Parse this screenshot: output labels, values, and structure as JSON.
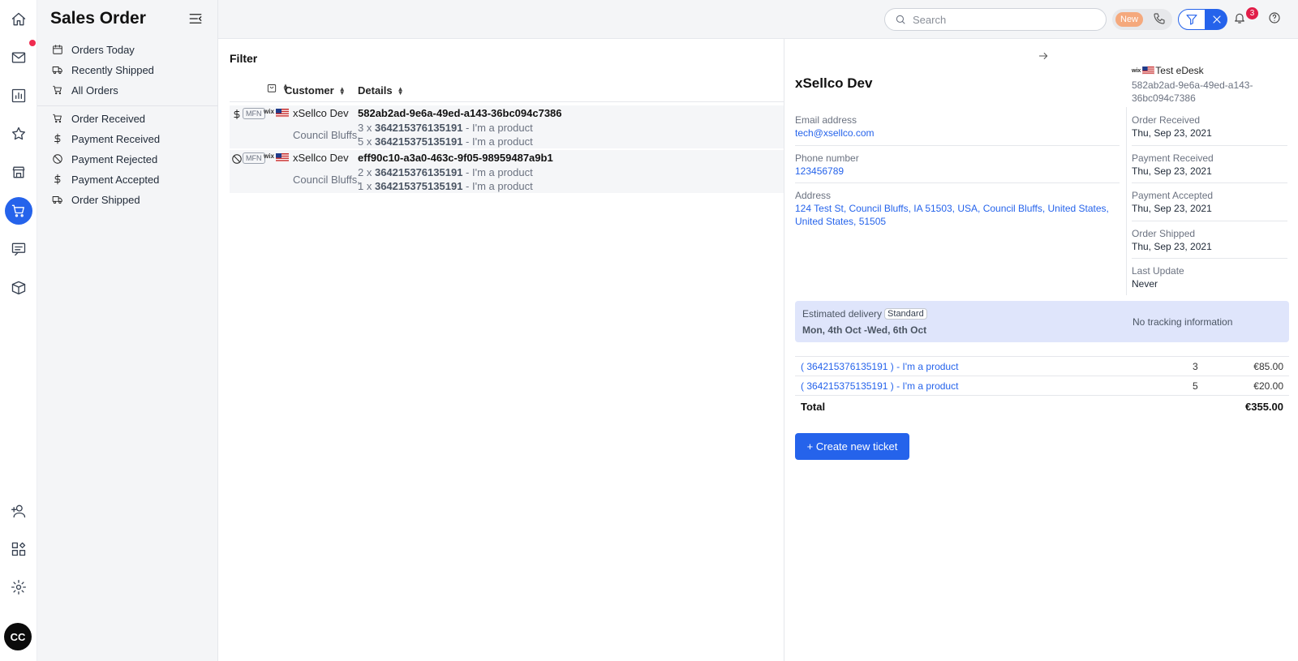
{
  "sidebar": {
    "title": "Sales Order",
    "items": [
      {
        "label": "Orders Today",
        "icon": "calendar-icon"
      },
      {
        "label": "Recently Shipped",
        "icon": "truck-icon"
      },
      {
        "label": "All Orders",
        "icon": "cart-icon"
      },
      {
        "label": "Order Received",
        "icon": "cart-icon"
      },
      {
        "label": "Payment Received",
        "icon": "dollar-icon"
      },
      {
        "label": "Payment Rejected",
        "icon": "ban-icon"
      },
      {
        "label": "Payment Accepted",
        "icon": "dollar-icon"
      },
      {
        "label": "Order Shipped",
        "icon": "truck-icon"
      }
    ]
  },
  "topbar": {
    "search_placeholder": "Search",
    "new_badge": "New",
    "notification_count": "3"
  },
  "list": {
    "filter_title": "Filter",
    "columns": {
      "customer": "Customer",
      "details": "Details"
    },
    "rows": [
      {
        "status_icon": "dollar-icon",
        "channel": "MFN",
        "marketplace": "wix",
        "customer": "xSellco Dev",
        "city": "Council Bluffs,",
        "order_id": "582ab2ad-9e6a-49ed-a143-36bc094c7386",
        "lines": [
          {
            "qty": "3 x ",
            "sku": "364215376135191",
            "name": " - I'm a product"
          },
          {
            "qty": "5 x ",
            "sku": "364215375135191",
            "name": " - I'm a product"
          }
        ]
      },
      {
        "status_icon": "ban-icon",
        "channel": "MFN",
        "marketplace": "wix",
        "customer": "xSellco Dev",
        "city": "Council Bluffs,",
        "order_id": "eff90c10-a3a0-463c-9f05-98959487a9b1",
        "lines": [
          {
            "qty": "2 x ",
            "sku": "364215376135191",
            "name": " - I'm a product"
          },
          {
            "qty": "1 x ",
            "sku": "364215375135191",
            "name": " - I'm a product"
          }
        ]
      }
    ]
  },
  "detail": {
    "customer_name": "xSellco Dev",
    "store_marketplace": "wix",
    "store_name": "Test eDesk",
    "order_id": "582ab2ad-9e6a-49ed-a143-36bc094c7386",
    "email_label": "Email address",
    "email": "tech@xsellco.com",
    "phone_label": "Phone number",
    "phone": "123456789",
    "address_label": "Address",
    "address_line1": "124 Test St, Council Bluffs, IA 51503, USA, Council Bluffs, United States,",
    "address_line2": "United States, 51505",
    "timeline": [
      {
        "label": "Order Received",
        "value": "Thu, Sep 23, 2021"
      },
      {
        "label": "Payment Received",
        "value": "Thu, Sep 23, 2021"
      },
      {
        "label": "Payment Accepted",
        "value": "Thu, Sep 23, 2021"
      },
      {
        "label": "Order Shipped",
        "value": "Thu, Sep 23, 2021"
      },
      {
        "label": "Last Update",
        "value": "Never"
      }
    ],
    "delivery": {
      "label": "Estimated delivery",
      "method": "Standard",
      "dates": "Mon, 4th Oct  -Wed, 6th Oct",
      "tracking": "No tracking information"
    },
    "products": [
      {
        "name": "( 364215376135191 ) - I'm a product",
        "qty": "3",
        "price": "€85.00"
      },
      {
        "name": "( 364215375135191 ) - I'm a product",
        "qty": "5",
        "price": "€20.00"
      }
    ],
    "total_label": "Total",
    "total_value": "€355.00",
    "create_ticket_label": "+ Create new ticket"
  },
  "colors": {
    "accent": "#2563eb",
    "notification": "#e11d48",
    "new_badge": "#f5a97d",
    "delivery_bg": "#dfe5fb"
  }
}
